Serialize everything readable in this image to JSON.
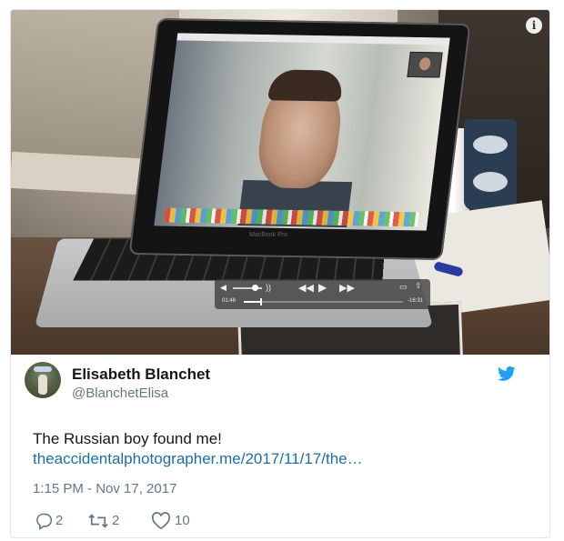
{
  "media": {
    "top_caption": "",
    "info_icon": "info-icon",
    "laptop_brand": "MacBook Pro",
    "video_controls": {
      "elapsed": "01:46",
      "remaining": "-16:31",
      "progress_fraction": 0.1,
      "volume_fraction": 0.75,
      "icons": [
        "volume-low-icon",
        "volume-high-icon",
        "rewind-icon",
        "play-icon",
        "fast-forward-icon",
        "airplay-icon",
        "share-icon"
      ]
    }
  },
  "tweet": {
    "author_name": "Elisabeth Blanchet",
    "author_handle": "@BlanchetElisa",
    "text_prefix": "The Russian boy found me! ",
    "link_text": "theaccidentalphotographer.me/2017/11/17/the…",
    "timestamp": "1:15 PM - Nov 17, 2017",
    "reply_count": "2",
    "retweet_count": "2",
    "like_count": "10",
    "brand_color": "#1da1f2",
    "link_color": "#1b6fa7"
  }
}
